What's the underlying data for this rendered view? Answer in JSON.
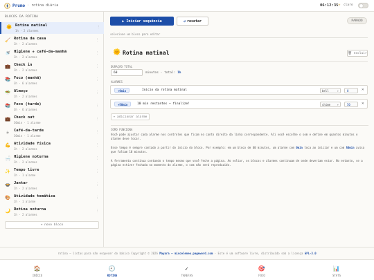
{
  "app": {
    "name": "Prumo",
    "subtitle": "rotina diária",
    "clock": "06:12:35",
    "theme_label": "claro",
    "theme_icon": "sun-icon"
  },
  "sidebar": {
    "title": "BLOCOS DA ROTINA",
    "add_label": "+ novo bloco",
    "blocks": [
      {
        "icon": "sunrise-icon",
        "glyph": "🌞",
        "name": "Rotina matinal",
        "meta": "1h · 2 alarmes",
        "active": true
      },
      {
        "icon": "broom-icon",
        "glyph": "🧹",
        "name": "Rotina da casa",
        "meta": "1h · 2 alarmes"
      },
      {
        "icon": "shower-icon",
        "glyph": "🚿",
        "name": "Higiene + café-da-manhã",
        "meta": "1h · 2 alarmes"
      },
      {
        "icon": "briefcase-icon",
        "glyph": "💼",
        "name": "Check in",
        "meta": "1h · 2 alarmes"
      },
      {
        "icon": "books-icon",
        "glyph": "📚",
        "name": "Foco (manhã)",
        "meta": "3h · 6 alarmes"
      },
      {
        "icon": "bowl-icon",
        "glyph": "🥗",
        "name": "Almoço",
        "meta": "1h · 2 alarmes"
      },
      {
        "icon": "books-icon",
        "glyph": "📚",
        "name": "Foco (tarde)",
        "meta": "3h · 6 alarmes"
      },
      {
        "icon": "briefcase-icon",
        "glyph": "💼",
        "name": "Check out",
        "meta": "30min · 1 alarme"
      },
      {
        "icon": "coffee-icon",
        "glyph": "☕",
        "name": "Café-da-tarde",
        "meta": "30min · 1 alarme"
      },
      {
        "icon": "dumbbell-icon",
        "glyph": "💪",
        "name": "Atividade física",
        "meta": "1h · 2 alarmes"
      },
      {
        "icon": "bath-icon",
        "glyph": "🛁",
        "name": "Higiene noturna",
        "meta": "1h · 2 alarmes"
      },
      {
        "icon": "sparkle-icon",
        "glyph": "✨",
        "name": "Tempo livre",
        "meta": "1h · 1 alarme"
      },
      {
        "icon": "plate-icon",
        "glyph": "🍲",
        "name": "Jantar",
        "meta": "1h · 2 alarmes"
      },
      {
        "icon": "palette-icon",
        "glyph": "🎨",
        "name": "Atividade temática",
        "meta": "1h · 1 alarme"
      },
      {
        "icon": "moon-icon",
        "glyph": "🌙",
        "name": "Rotina noturna",
        "meta": "1h · 2 alarmes"
      }
    ]
  },
  "toolbar": {
    "start_label": "Iniciar sequência",
    "reset_label": "resetar",
    "status": "PARADO"
  },
  "hint": "selecione um bloco para editar",
  "editor": {
    "title": "Rotina matinal",
    "delete_label": "excluir",
    "duration_label": "DURAÇÃO TOTAL",
    "duration_value": "60",
    "duration_unit": "minutos · total:",
    "duration_total": "1h",
    "alarms_label": "ALARMES",
    "alarms": [
      {
        "offset": "+0min",
        "message": "Início da rotina matinal",
        "sound": "bell",
        "volume": "0"
      },
      {
        "offset": "+50min",
        "message": "10 min restantes — finalize!",
        "sound": "chime",
        "volume": "50"
      }
    ],
    "add_alarm_label": "+ adicionar alarme"
  },
  "how": {
    "title": "COMO FUNCIONA",
    "p1": "Você pode ajustar cada alarme nos controles que ficam no canto direito da linha correspondente. Ali você escolhe o som e define em quantos minutos o alarme deve tocar.",
    "p2_a": "Esse tempo é sempre contado a partir do início do bloco. Por exemplo: em um bloco de 60 minutos, um alarme com ",
    "p2_k1": "0min",
    "p2_b": " toca ao iniciar e um com ",
    "p2_k2": "50min",
    "p2_c": " avisa que faltam 10 minutos.",
    "p3": "A ferramenta continua contando o tempo mesmo que você feche a página. Ao voltar, os blocos e alarmes continuam de onde deveriam estar. No entanto, se a página estiver fechada no momento do alarme, o som não será reproduzido."
  },
  "footer": {
    "a": "rotina — listas para não esquecer do básico Copyright © 2026 ",
    "author": "Mayara — misceleneo.pageword.com",
    "b": " · Este é um software livre, distribuído sob a licença ",
    "license": "GPL-3.0"
  },
  "nav": [
    {
      "icon": "home-icon",
      "glyph": "🏠",
      "label": "INÍCIO"
    },
    {
      "icon": "clock-icon",
      "glyph": "🕘",
      "label": "ROTINA",
      "active": true
    },
    {
      "icon": "check-icon",
      "glyph": "✓",
      "label": "TAREFAS"
    },
    {
      "icon": "target-icon",
      "glyph": "🎯",
      "label": "FOCO"
    },
    {
      "icon": "stats-icon",
      "glyph": "📊",
      "label": "STATS"
    }
  ]
}
